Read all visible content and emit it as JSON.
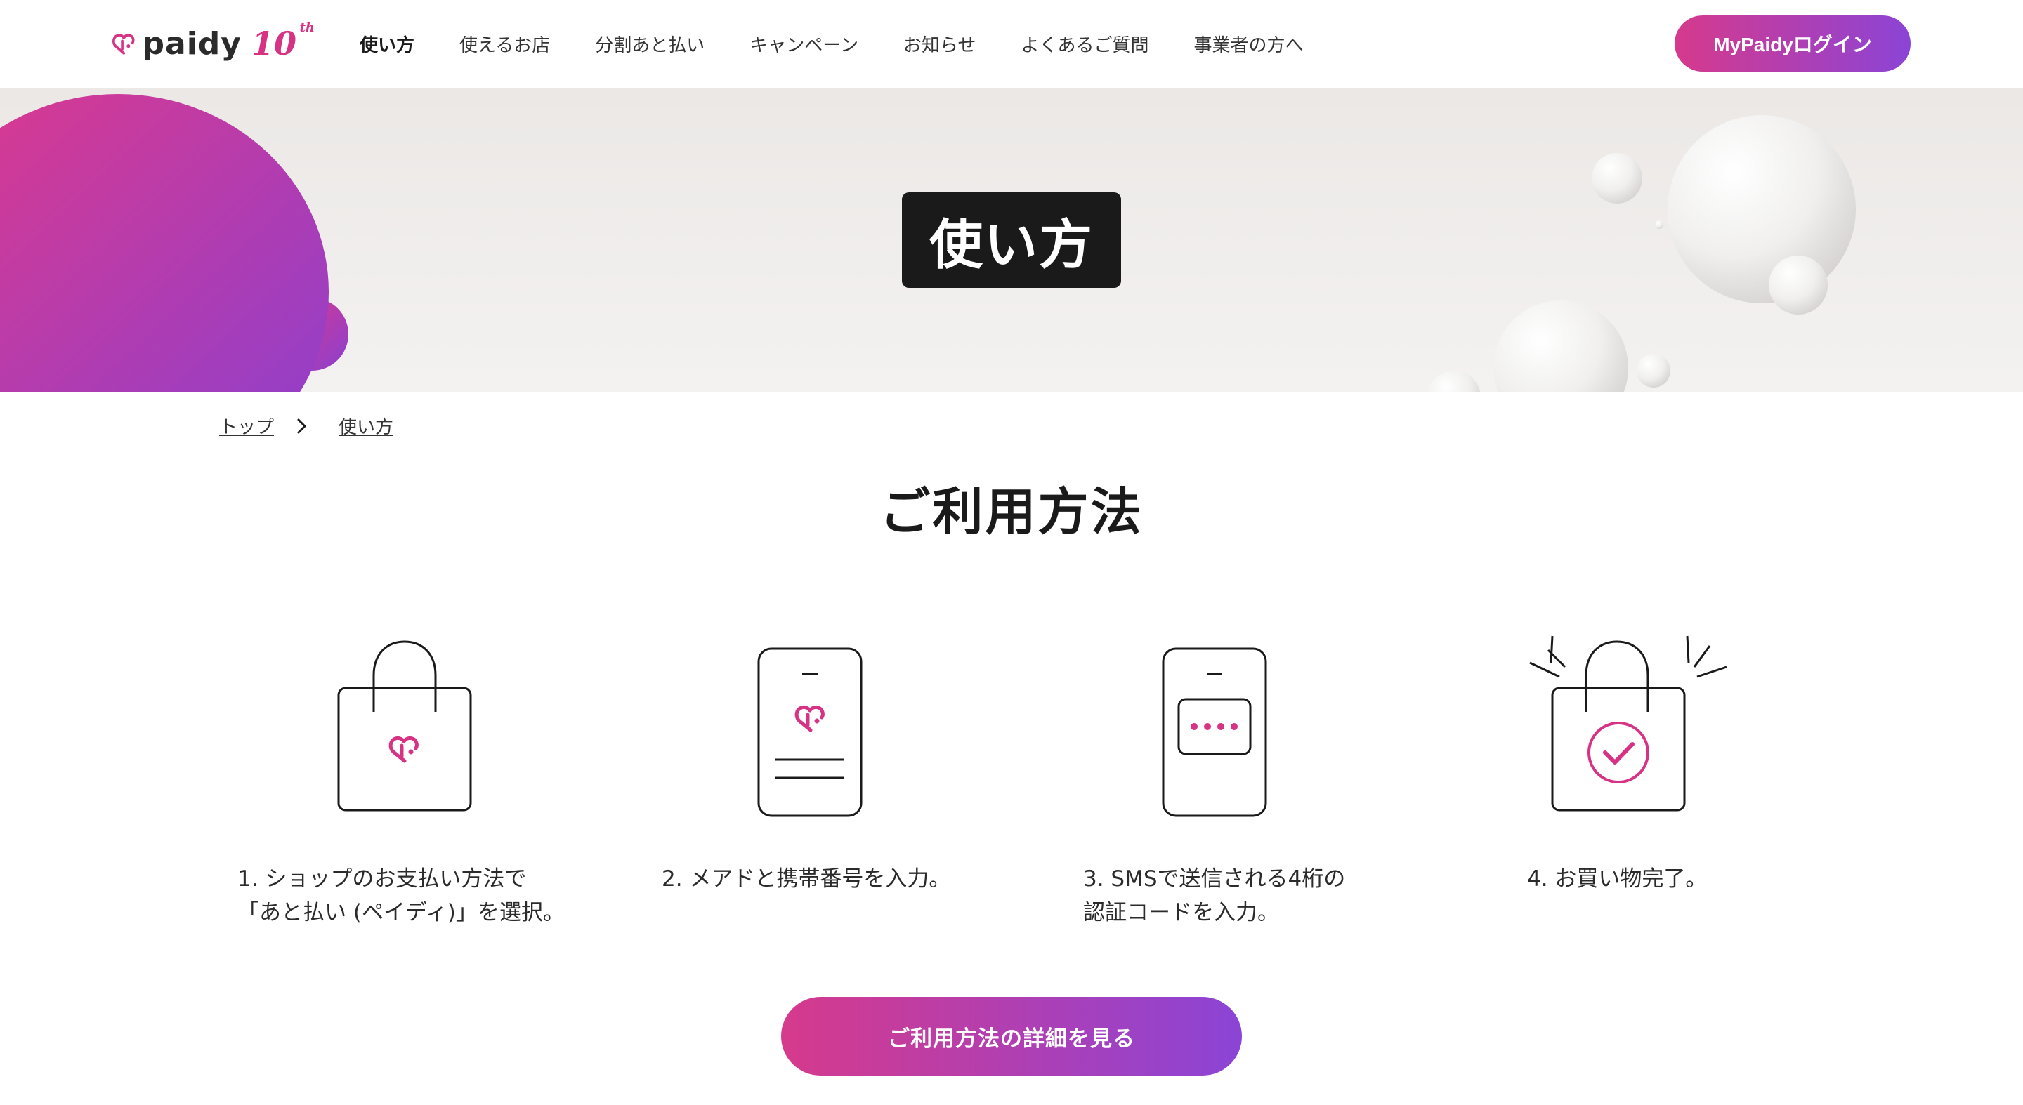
{
  "header": {
    "logo_text": "paidy",
    "logo_ten": "10",
    "logo_th": "th",
    "nav": [
      {
        "label": "使い方",
        "active": true
      },
      {
        "label": "使えるお店",
        "active": false
      },
      {
        "label": "分割あと払い",
        "active": false
      },
      {
        "label": "キャンペーン",
        "active": false
      },
      {
        "label": "お知らせ",
        "active": false
      },
      {
        "label": "よくあるご質問",
        "active": false
      },
      {
        "label": "事業者の方へ",
        "active": false
      }
    ],
    "login_label": "MyPaidyログイン"
  },
  "hero": {
    "title": "使い方"
  },
  "breadcrumb": {
    "items": [
      "トップ",
      "使い方"
    ]
  },
  "section": {
    "title": "ご利用方法",
    "steps": [
      {
        "line1": "1. ショップのお支払い方法で",
        "line2": "「あと払い (ペイディ)」を選択。",
        "icon": "shopping-bag-paidy-icon"
      },
      {
        "line1": "2. メアドと携帯番号を入力。",
        "line2": "",
        "icon": "phone-form-icon"
      },
      {
        "line1": "3. SMSで送信される4桁の",
        "line2": "認証コードを入力。",
        "icon": "phone-code-icon"
      },
      {
        "line1": "4. お買い物完了。",
        "line2": "",
        "icon": "shopping-bag-check-icon"
      }
    ],
    "cta_label": "ご利用方法の詳細を見る"
  },
  "colors": {
    "brand_pink": "#d63a8c",
    "brand_purple": "#8b44d6",
    "hero_bg": "#ebe8e6"
  }
}
